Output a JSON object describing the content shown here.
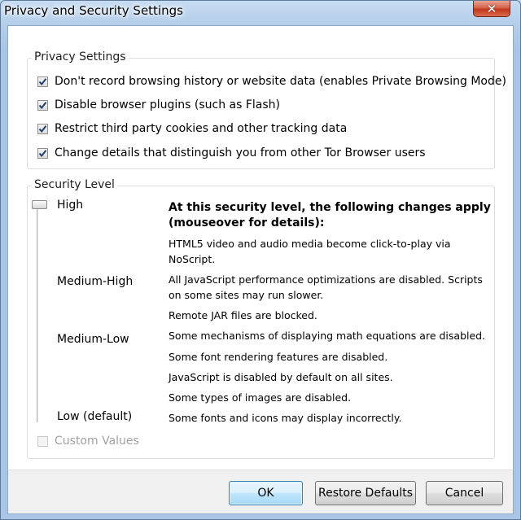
{
  "window": {
    "title": "Privacy and Security Settings",
    "close_symbol": "✕"
  },
  "privacy": {
    "group_label": "Privacy Settings",
    "options": [
      {
        "label": "Don't record browsing history or website data (enables Private Browsing Mode)",
        "checked": true
      },
      {
        "label": "Disable browser plugins (such as Flash)",
        "checked": true
      },
      {
        "label": "Restrict third party cookies and other tracking data",
        "checked": true
      },
      {
        "label": "Change details that distinguish you from other Tor Browser users",
        "checked": true
      }
    ]
  },
  "security": {
    "group_label": "Security Level",
    "levels": [
      "High",
      "Medium-High",
      "Medium-Low",
      "Low (default)"
    ],
    "selected_level": "High",
    "description_heading": "At this security level, the following changes apply (mouseover for details):",
    "descriptions": [
      "HTML5 video and audio media become click-to-play via NoScript.",
      "All JavaScript performance optimizations are disabled. Scripts on some sites may run slower.",
      "Remote JAR files are blocked.",
      "Some mechanisms of displaying math equations are disabled.",
      "Some font rendering features are disabled.",
      "JavaScript is disabled by default on all sites.",
      "Some types of images are disabled.",
      "Some fonts and icons may display incorrectly."
    ],
    "custom_values_label": "Custom Values",
    "custom_values_checked": false
  },
  "buttons": {
    "ok": "OK",
    "restore_defaults": "Restore Defaults",
    "cancel": "Cancel"
  },
  "colors": {
    "accent": "#3c7fb1",
    "window_frame": "#a9c6e6",
    "close_button": "#c2381c"
  }
}
